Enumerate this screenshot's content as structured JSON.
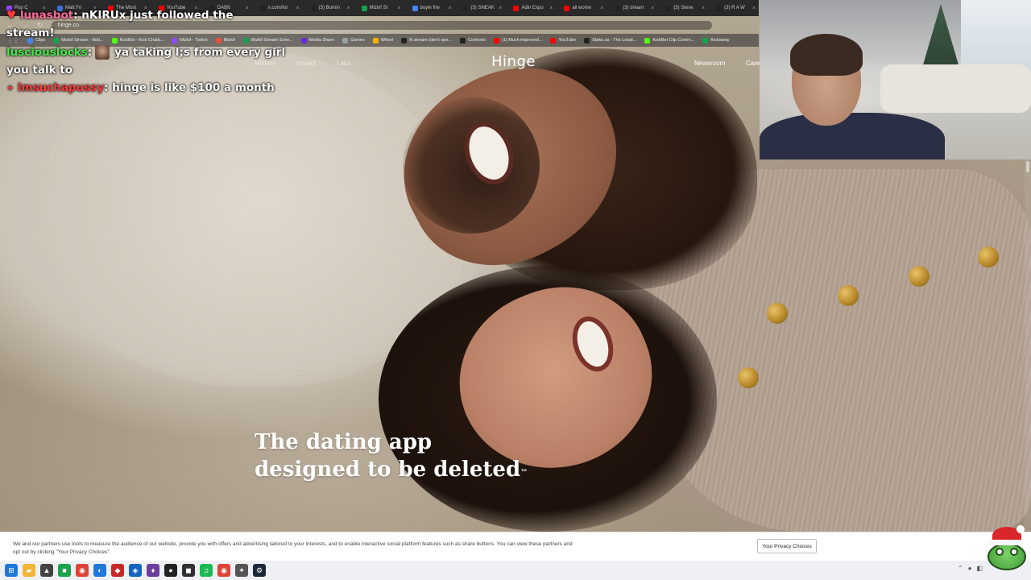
{
  "browser": {
    "tabs": [
      {
        "label": "Pop C",
        "color": "#9146ff"
      },
      {
        "label": "Matt Fri",
        "color": "#3e6fd6"
      },
      {
        "label": "The Most",
        "color": "#ff0000"
      },
      {
        "label": "YouTube",
        "color": "#ff0000"
      },
      {
        "label": "DABIt",
        "color": "#222222"
      },
      {
        "label": "x.com/ho",
        "color": "#222222"
      },
      {
        "label": "(3) Burnin",
        "color": "#222222"
      },
      {
        "label": "Mizkif St",
        "color": "#16a34a"
      },
      {
        "label": "boyle frie",
        "color": "#4285f4"
      },
      {
        "label": "(3) SNEAK",
        "color": "#222222"
      },
      {
        "label": "Adin Expo",
        "color": "#ff0000"
      },
      {
        "label": "all wome",
        "color": "#ff0000"
      },
      {
        "label": "(3) dream",
        "color": "#222222"
      },
      {
        "label": "(3) Steve",
        "color": "#222222"
      },
      {
        "label": "(3) R A W",
        "color": "#222222"
      }
    ],
    "url": "hinge.co",
    "bookmarks": [
      {
        "label": "Clips",
        "color": "#4285f4"
      },
      {
        "label": "Mizkif Stream - Wat...",
        "color": "#16a34a"
      },
      {
        "label": "KickBot - Kick Chatb...",
        "color": "#53fc18"
      },
      {
        "label": "Mizkif - Twitch",
        "color": "#9146ff"
      },
      {
        "label": "Mizkif",
        "color": "#e5533d"
      },
      {
        "label": "Mizkif Stream Sche...",
        "color": "#16a34a"
      },
      {
        "label": "Media Share",
        "color": "#6d28d9"
      },
      {
        "label": "Games",
        "color": "#9aa0a6"
      },
      {
        "label": "Wheel",
        "color": "#f4b400"
      },
      {
        "label": "R.stream (don't ope...",
        "color": "#222222"
      },
      {
        "label": "Contexto",
        "color": "#222222"
      },
      {
        "label": "(1) Much improved...",
        "color": "#ff0000"
      },
      {
        "label": "YouTube",
        "color": "#ff0000"
      },
      {
        "label": "Stake.us - The Leadi...",
        "color": "#222222"
      },
      {
        "label": "KickBot Clip Comm...",
        "color": "#53fc18"
      },
      {
        "label": "Kickaway",
        "color": "#16a34a"
      }
    ]
  },
  "site": {
    "brand": "Hinge",
    "nav_left": [
      "Mission",
      "Impact",
      "Labs"
    ],
    "nav_right": [
      "Newsroom",
      "Care"
    ],
    "headline_line1": "The dating app",
    "headline_line2": "designed to be deleted",
    "trademark": "™"
  },
  "chat": {
    "follow_user": "lunasbot",
    "follow_text": ": nKIRUx just followed the",
    "follow_text_2": "stream!",
    "msg1_user": "lusciouslocks",
    "msg1_text": "ya taking l;s from every girl",
    "msg1_text_2": "you talk to",
    "msg2_user": "imsuchapussy",
    "msg2_text": ": hinge is like $100 a month"
  },
  "cookie_banner": {
    "text": "We and our partners use tools to measure the audience of our website, provide you with offers and advertising tailored to your interests, and to enable interactive social platform features such as share buttons. You can view these partners and opt out by clicking \"Your Privacy Choices\".",
    "button_label": "Your Privacy Choices"
  },
  "taskbar": {
    "icons": [
      {
        "name": "windows-start",
        "color": "#1e78d7",
        "glyph": "⊞"
      },
      {
        "name": "file-explorer",
        "color": "#f1b53a",
        "glyph": "▰"
      },
      {
        "name": "app-1",
        "color": "#444444",
        "glyph": "▲"
      },
      {
        "name": "app-green",
        "color": "#1aa34a",
        "glyph": "■"
      },
      {
        "name": "chrome",
        "color": "#db4437",
        "glyph": "◉"
      },
      {
        "name": "edge",
        "color": "#1e78d7",
        "glyph": "◐"
      },
      {
        "name": "app-red",
        "color": "#c62828",
        "glyph": "◆"
      },
      {
        "name": "app-blue",
        "color": "#1565c0",
        "glyph": "◈"
      },
      {
        "name": "app-purple",
        "color": "#6b3fa0",
        "glyph": "♦"
      },
      {
        "name": "obs",
        "color": "#222222",
        "glyph": "●"
      },
      {
        "name": "app-dark",
        "color": "#303030",
        "glyph": "◼"
      },
      {
        "name": "spotify",
        "color": "#1db954",
        "glyph": "♫"
      },
      {
        "name": "chrome-alt",
        "color": "#db4437",
        "glyph": "◉"
      },
      {
        "name": "app-misc",
        "color": "#555555",
        "glyph": "✦"
      },
      {
        "name": "steam",
        "color": "#1b2838",
        "glyph": "⚙"
      }
    ]
  }
}
